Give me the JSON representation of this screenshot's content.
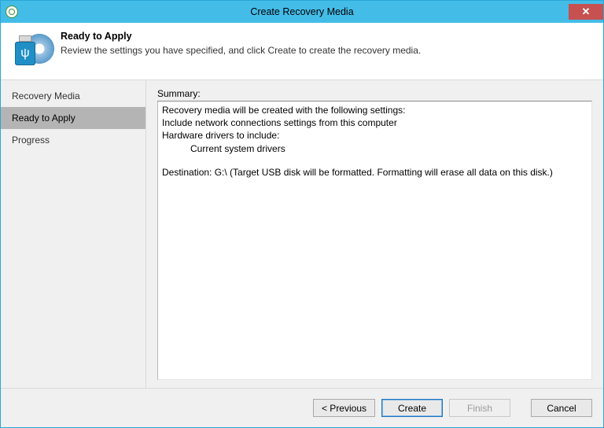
{
  "window": {
    "title": "Create Recovery Media",
    "close_glyph": "✕"
  },
  "header": {
    "title": "Ready to Apply",
    "subtitle": "Review the settings you have specified, and click Create to create the recovery media.",
    "usb_glyph": "ψ"
  },
  "sidebar": {
    "steps": [
      {
        "label": "Recovery Media",
        "active": false
      },
      {
        "label": "Ready to Apply",
        "active": true
      },
      {
        "label": "Progress",
        "active": false
      }
    ]
  },
  "summary": {
    "label": "Summary:",
    "line1": "Recovery media will be created with the following settings:",
    "line2": "Include network connections settings from this computer",
    "line3": "Hardware drivers to include:",
    "line4": "Current system drivers",
    "line5": "Destination: G:\\ (Target USB disk will be formatted. Formatting will erase all data on this disk.)"
  },
  "buttons": {
    "previous": "< Previous",
    "create": "Create",
    "finish": "Finish",
    "cancel": "Cancel"
  }
}
